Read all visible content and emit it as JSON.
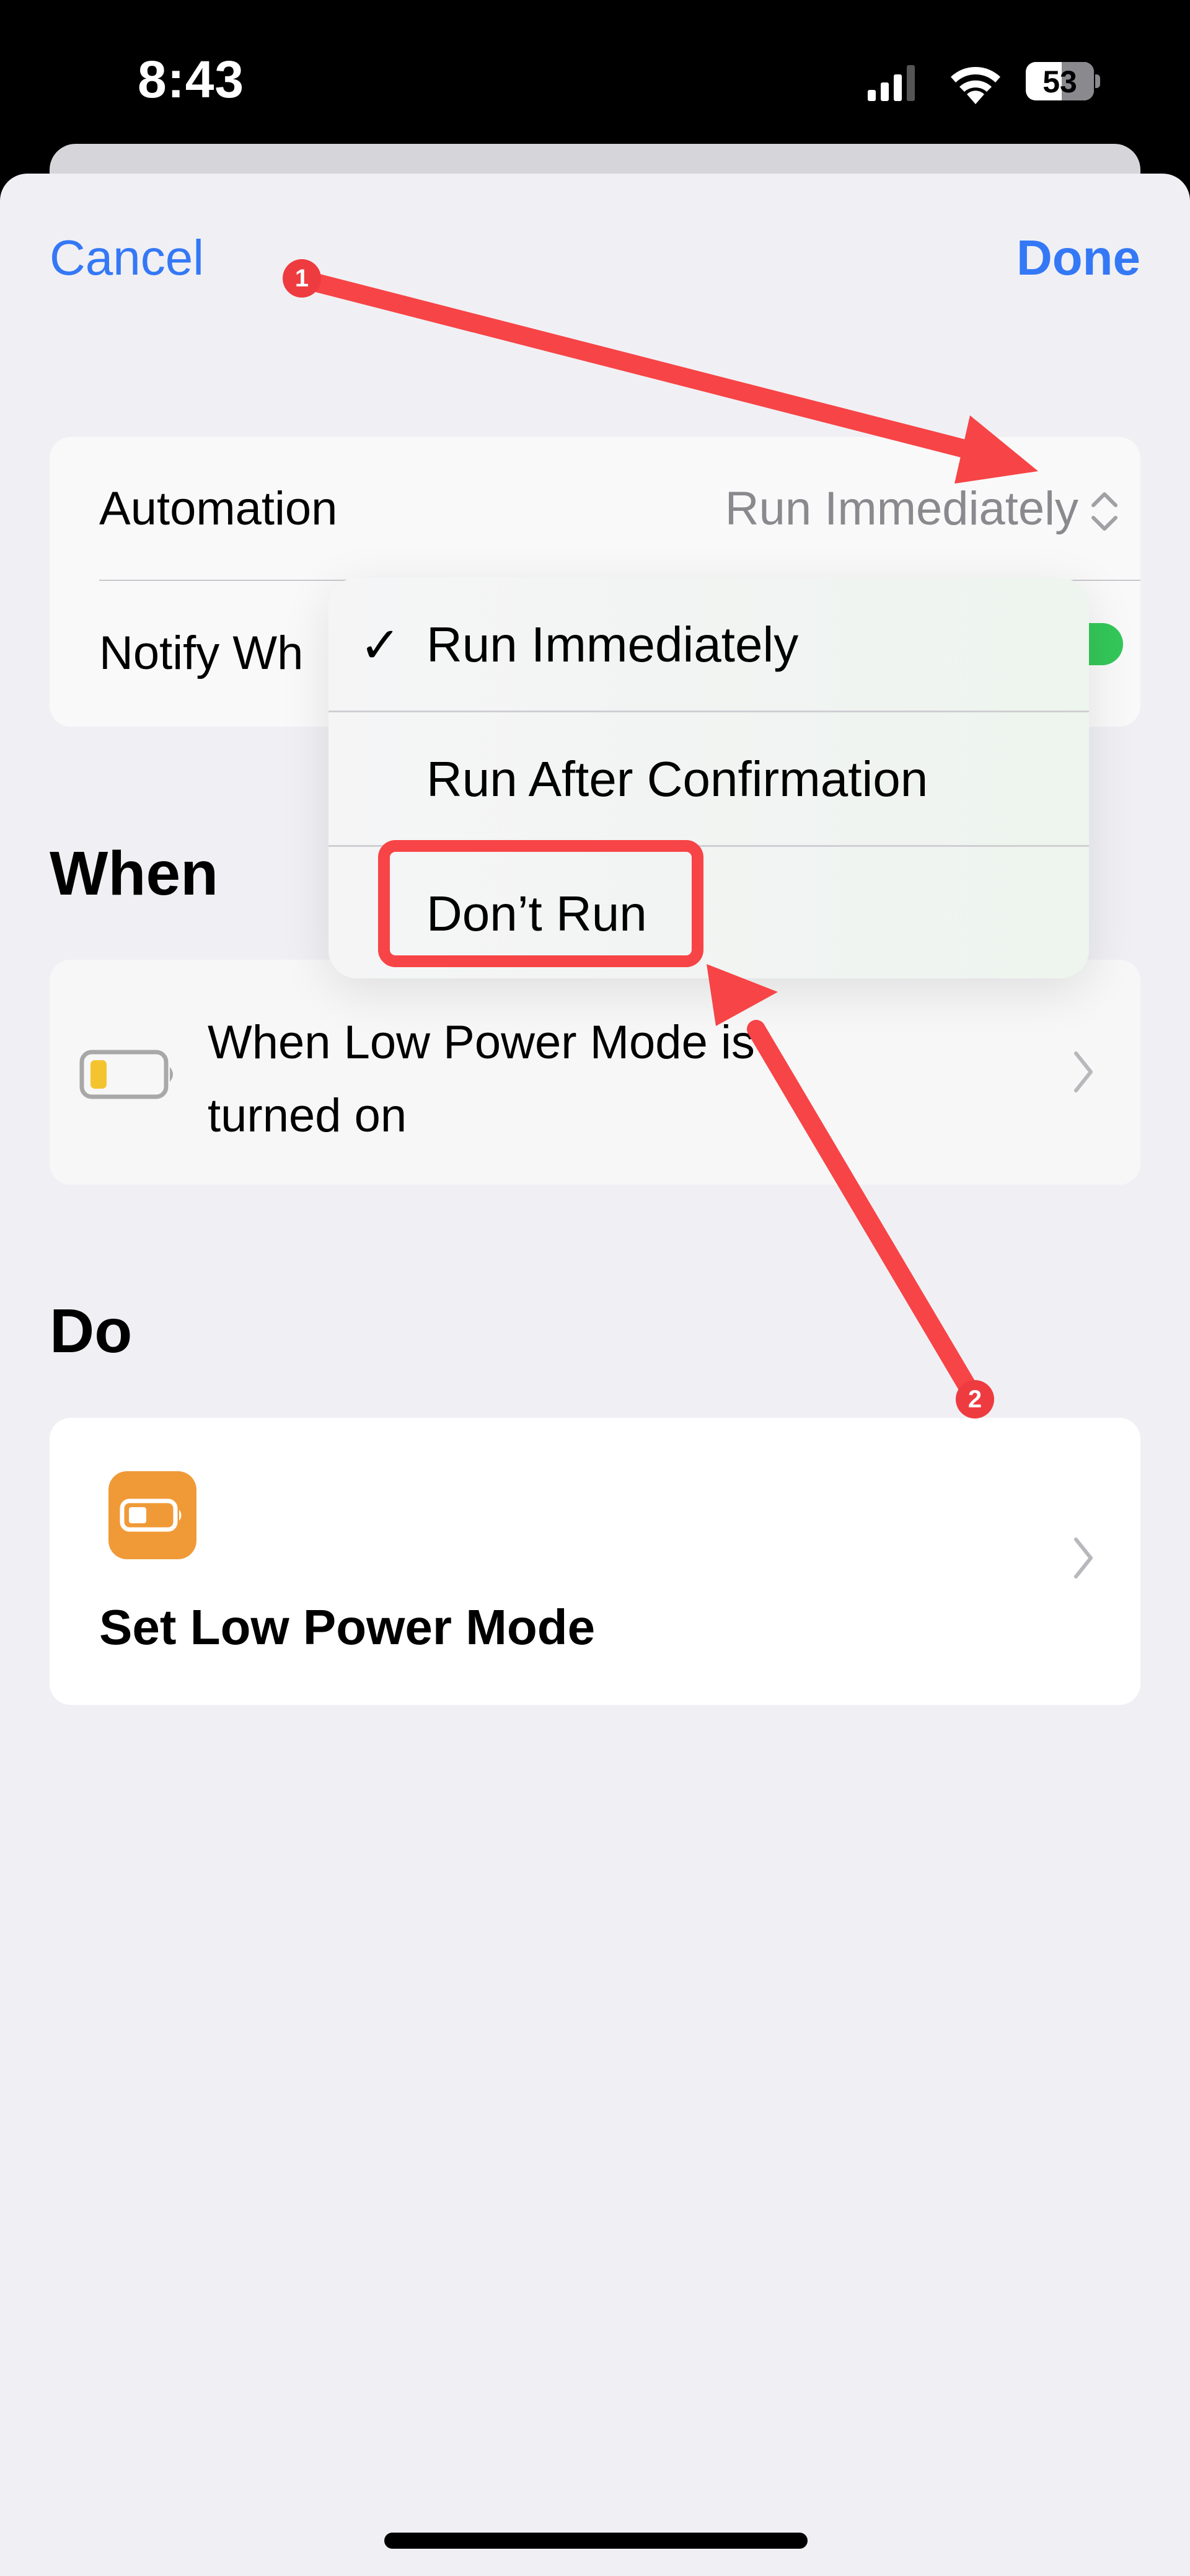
{
  "status_bar": {
    "time": "8:43",
    "battery_percent": "53",
    "icons": [
      "cellular-signal-icon",
      "wifi-icon",
      "battery-icon"
    ]
  },
  "nav": {
    "cancel_label": "Cancel",
    "done_label": "Done"
  },
  "settings": {
    "automation_label": "Automation",
    "automation_value": "Run Immediately",
    "notify_label": "Notify Wh",
    "notify_enabled": true
  },
  "menu": {
    "items": [
      {
        "label": "Run Immediately",
        "selected": true
      },
      {
        "label": "Run After Confirmation",
        "selected": false
      },
      {
        "label": "Don’t Run",
        "selected": false
      }
    ],
    "check_glyph": "✓"
  },
  "when": {
    "header": "When",
    "trigger_text": "When Low Power Mode is turned on",
    "icon": "low-battery-icon"
  },
  "do": {
    "header": "Do",
    "action_title": "Set Low Power Mode",
    "icon": "low-power-mode-icon"
  },
  "annotations": {
    "badge_1": "1",
    "badge_2": "2",
    "color": "#f74446"
  },
  "colors": {
    "accent": "#3478f6",
    "toggle_on": "#34c759",
    "action_icon_bg": "#f09a37",
    "trigger_icon_fill": "#f4c430",
    "background": "#f0f0f4"
  }
}
